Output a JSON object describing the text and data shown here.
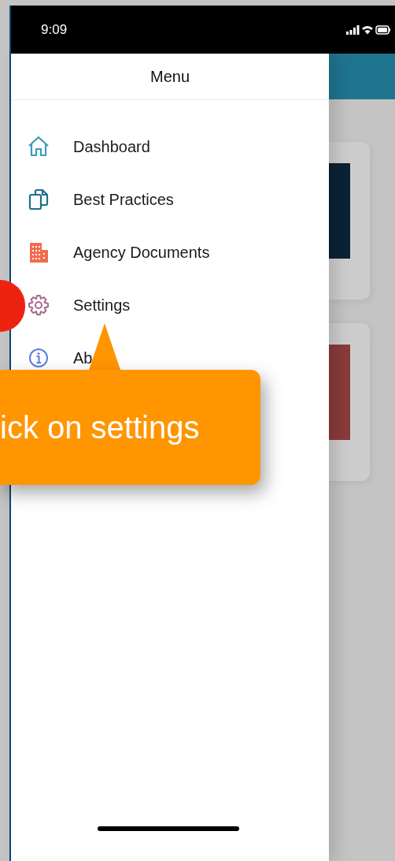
{
  "status_bar": {
    "time": "9:09"
  },
  "menu": {
    "title": "Menu",
    "items": [
      {
        "kind": "home",
        "label": "Dashboard"
      },
      {
        "kind": "documents",
        "label": "Best Practices"
      },
      {
        "kind": "building",
        "label": "Agency Documents"
      },
      {
        "kind": "gear",
        "label": "Settings"
      },
      {
        "kind": "info",
        "label": "Ab"
      }
    ]
  },
  "background_cards": [
    {
      "kind": "circuit"
    },
    {
      "kind": "lights"
    }
  ],
  "tooltip": {
    "text": "ick on settings"
  }
}
